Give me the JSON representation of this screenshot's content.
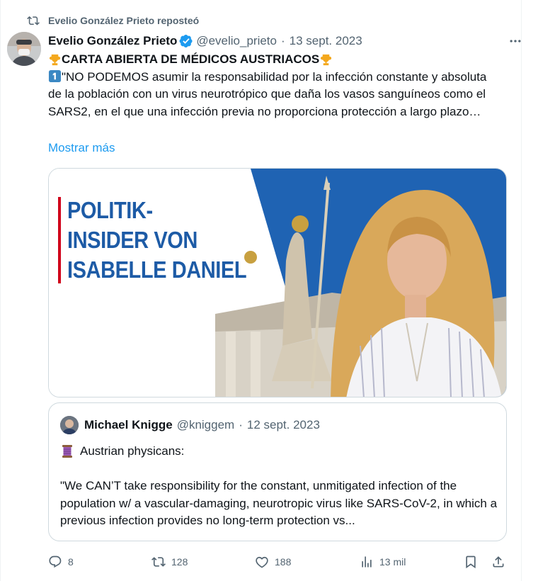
{
  "repost": {
    "label": "Evelio González Prieto reposteó",
    "icon": "repost-icon"
  },
  "tweet": {
    "author_name": "Evelio González Prieto",
    "verified": true,
    "handle": "@evelio_prieto",
    "separator": "·",
    "date": "13 sept. 2023",
    "title": "CARTA ABIERTA DE MÉDICOS AUSTRIACOS",
    "body": "\"NO PODEMOS asumir la responsabilidad por la infección constante y absoluta de la población con un virus neurotrópico que daña los vasos sanguíneos como el SARS2, en el que una infección previa no proporciona protección a largo plazo…",
    "show_more": "Mostrar más",
    "image_headline": [
      "POLITIK-",
      "INSIDER VON",
      "ISABELLE DANIEL"
    ]
  },
  "quote": {
    "author_name": "Michael Knigge",
    "handle": "@kniggem",
    "separator": "·",
    "date": "12 sept. 2023",
    "line1": "Austrian physicans:",
    "body": "\"We CAN’T take responsibility for the constant, unmitigated infection of the population w/ a vascular-damaging, neurotropic virus like SARS-CoV-2, in which a previous infection provides no long-term protection vs..."
  },
  "actions": {
    "replies": "8",
    "reposts": "128",
    "likes": "188",
    "views": "13 mil"
  },
  "colors": {
    "accent": "#1d9bf0",
    "secondary_text": "#536471",
    "border": "#cfd9de"
  }
}
